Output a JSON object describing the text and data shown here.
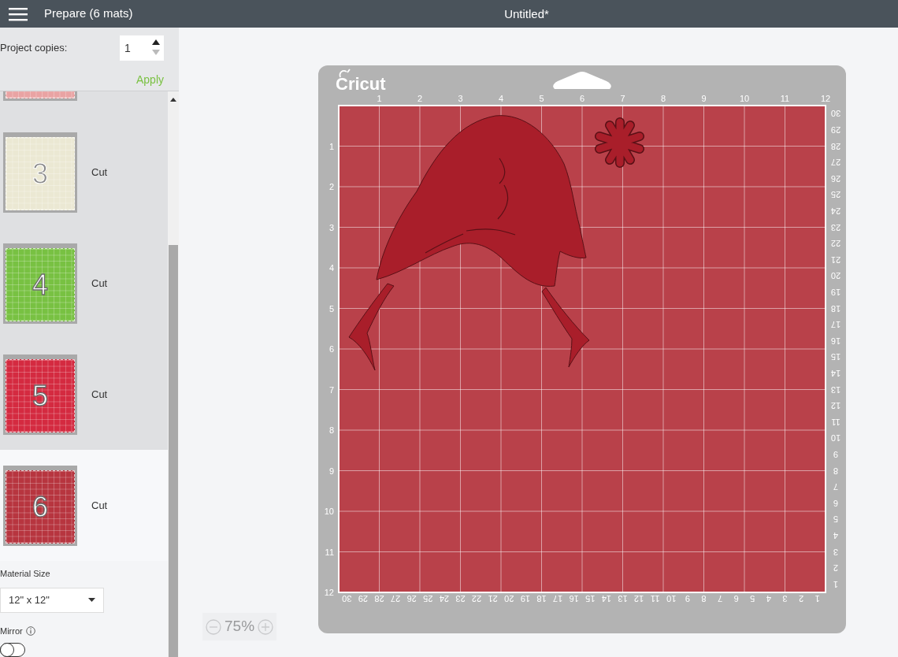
{
  "header": {
    "title": "Prepare (6 mats)",
    "document_title": "Untitled*"
  },
  "sidebar": {
    "project_copies": {
      "label": "Project copies:",
      "value": "1"
    },
    "apply": "Apply",
    "mats": [
      {
        "kind": "partial",
        "color": "#e9a3a3",
        "selected": false
      },
      {
        "kind": "full",
        "number": "3",
        "action": "Cut",
        "color": "#ebe8d3",
        "selected": false
      },
      {
        "kind": "full",
        "number": "4",
        "action": "Cut",
        "color": "#78c142",
        "selected": false
      },
      {
        "kind": "full",
        "number": "5",
        "action": "Cut",
        "color": "#d42a40",
        "selected": false
      },
      {
        "kind": "full",
        "number": "6",
        "action": "Cut",
        "color": "#b7353f",
        "selected": true
      }
    ],
    "material_size": {
      "label": "Material Size",
      "value": "12\" x 12\""
    },
    "mirror": {
      "label": "Mirror",
      "on": false
    }
  },
  "canvas": {
    "mat": {
      "brand": "Cricut",
      "top_ruler": [
        "1",
        "2",
        "3",
        "4",
        "5",
        "6",
        "7",
        "8",
        "9",
        "10",
        "11",
        "12"
      ],
      "left_ruler": [
        "1",
        "2",
        "3",
        "4",
        "5",
        "6",
        "7",
        "8",
        "9",
        "10",
        "11",
        "12"
      ],
      "right_ruler": [
        "30",
        "29",
        "28",
        "27",
        "26",
        "25",
        "24",
        "23",
        "22",
        "21",
        "20",
        "19",
        "18",
        "17",
        "16",
        "15",
        "14",
        "13",
        "12",
        "11",
        "10",
        "9",
        "8",
        "7",
        "6",
        "5",
        "4",
        "3",
        "2",
        "1"
      ],
      "bottom_ruler": [
        "30",
        "29",
        "28",
        "27",
        "26",
        "25",
        "24",
        "23",
        "22",
        "21",
        "20",
        "19",
        "18",
        "17",
        "16",
        "15",
        "14",
        "13",
        "12",
        "11",
        "10",
        "9",
        "8",
        "7",
        "6",
        "5",
        "4",
        "3",
        "2",
        "1"
      ]
    },
    "zoom": "75%"
  }
}
